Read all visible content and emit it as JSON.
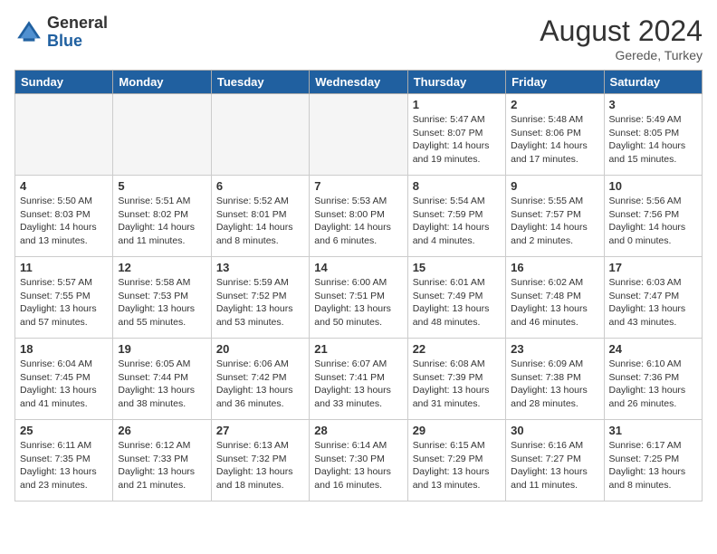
{
  "header": {
    "logo_general": "General",
    "logo_blue": "Blue",
    "month_year": "August 2024",
    "location": "Gerede, Turkey"
  },
  "weekdays": [
    "Sunday",
    "Monday",
    "Tuesday",
    "Wednesday",
    "Thursday",
    "Friday",
    "Saturday"
  ],
  "weeks": [
    [
      {
        "day": "",
        "info": "",
        "empty": true
      },
      {
        "day": "",
        "info": "",
        "empty": true
      },
      {
        "day": "",
        "info": "",
        "empty": true
      },
      {
        "day": "",
        "info": "",
        "empty": true
      },
      {
        "day": "1",
        "info": "Sunrise: 5:47 AM\nSunset: 8:07 PM\nDaylight: 14 hours\nand 19 minutes.",
        "empty": false
      },
      {
        "day": "2",
        "info": "Sunrise: 5:48 AM\nSunset: 8:06 PM\nDaylight: 14 hours\nand 17 minutes.",
        "empty": false
      },
      {
        "day": "3",
        "info": "Sunrise: 5:49 AM\nSunset: 8:05 PM\nDaylight: 14 hours\nand 15 minutes.",
        "empty": false
      }
    ],
    [
      {
        "day": "4",
        "info": "Sunrise: 5:50 AM\nSunset: 8:03 PM\nDaylight: 14 hours\nand 13 minutes.",
        "empty": false
      },
      {
        "day": "5",
        "info": "Sunrise: 5:51 AM\nSunset: 8:02 PM\nDaylight: 14 hours\nand 11 minutes.",
        "empty": false
      },
      {
        "day": "6",
        "info": "Sunrise: 5:52 AM\nSunset: 8:01 PM\nDaylight: 14 hours\nand 8 minutes.",
        "empty": false
      },
      {
        "day": "7",
        "info": "Sunrise: 5:53 AM\nSunset: 8:00 PM\nDaylight: 14 hours\nand 6 minutes.",
        "empty": false
      },
      {
        "day": "8",
        "info": "Sunrise: 5:54 AM\nSunset: 7:59 PM\nDaylight: 14 hours\nand 4 minutes.",
        "empty": false
      },
      {
        "day": "9",
        "info": "Sunrise: 5:55 AM\nSunset: 7:57 PM\nDaylight: 14 hours\nand 2 minutes.",
        "empty": false
      },
      {
        "day": "10",
        "info": "Sunrise: 5:56 AM\nSunset: 7:56 PM\nDaylight: 14 hours\nand 0 minutes.",
        "empty": false
      }
    ],
    [
      {
        "day": "11",
        "info": "Sunrise: 5:57 AM\nSunset: 7:55 PM\nDaylight: 13 hours\nand 57 minutes.",
        "empty": false
      },
      {
        "day": "12",
        "info": "Sunrise: 5:58 AM\nSunset: 7:53 PM\nDaylight: 13 hours\nand 55 minutes.",
        "empty": false
      },
      {
        "day": "13",
        "info": "Sunrise: 5:59 AM\nSunset: 7:52 PM\nDaylight: 13 hours\nand 53 minutes.",
        "empty": false
      },
      {
        "day": "14",
        "info": "Sunrise: 6:00 AM\nSunset: 7:51 PM\nDaylight: 13 hours\nand 50 minutes.",
        "empty": false
      },
      {
        "day": "15",
        "info": "Sunrise: 6:01 AM\nSunset: 7:49 PM\nDaylight: 13 hours\nand 48 minutes.",
        "empty": false
      },
      {
        "day": "16",
        "info": "Sunrise: 6:02 AM\nSunset: 7:48 PM\nDaylight: 13 hours\nand 46 minutes.",
        "empty": false
      },
      {
        "day": "17",
        "info": "Sunrise: 6:03 AM\nSunset: 7:47 PM\nDaylight: 13 hours\nand 43 minutes.",
        "empty": false
      }
    ],
    [
      {
        "day": "18",
        "info": "Sunrise: 6:04 AM\nSunset: 7:45 PM\nDaylight: 13 hours\nand 41 minutes.",
        "empty": false
      },
      {
        "day": "19",
        "info": "Sunrise: 6:05 AM\nSunset: 7:44 PM\nDaylight: 13 hours\nand 38 minutes.",
        "empty": false
      },
      {
        "day": "20",
        "info": "Sunrise: 6:06 AM\nSunset: 7:42 PM\nDaylight: 13 hours\nand 36 minutes.",
        "empty": false
      },
      {
        "day": "21",
        "info": "Sunrise: 6:07 AM\nSunset: 7:41 PM\nDaylight: 13 hours\nand 33 minutes.",
        "empty": false
      },
      {
        "day": "22",
        "info": "Sunrise: 6:08 AM\nSunset: 7:39 PM\nDaylight: 13 hours\nand 31 minutes.",
        "empty": false
      },
      {
        "day": "23",
        "info": "Sunrise: 6:09 AM\nSunset: 7:38 PM\nDaylight: 13 hours\nand 28 minutes.",
        "empty": false
      },
      {
        "day": "24",
        "info": "Sunrise: 6:10 AM\nSunset: 7:36 PM\nDaylight: 13 hours\nand 26 minutes.",
        "empty": false
      }
    ],
    [
      {
        "day": "25",
        "info": "Sunrise: 6:11 AM\nSunset: 7:35 PM\nDaylight: 13 hours\nand 23 minutes.",
        "empty": false
      },
      {
        "day": "26",
        "info": "Sunrise: 6:12 AM\nSunset: 7:33 PM\nDaylight: 13 hours\nand 21 minutes.",
        "empty": false
      },
      {
        "day": "27",
        "info": "Sunrise: 6:13 AM\nSunset: 7:32 PM\nDaylight: 13 hours\nand 18 minutes.",
        "empty": false
      },
      {
        "day": "28",
        "info": "Sunrise: 6:14 AM\nSunset: 7:30 PM\nDaylight: 13 hours\nand 16 minutes.",
        "empty": false
      },
      {
        "day": "29",
        "info": "Sunrise: 6:15 AM\nSunset: 7:29 PM\nDaylight: 13 hours\nand 13 minutes.",
        "empty": false
      },
      {
        "day": "30",
        "info": "Sunrise: 6:16 AM\nSunset: 7:27 PM\nDaylight: 13 hours\nand 11 minutes.",
        "empty": false
      },
      {
        "day": "31",
        "info": "Sunrise: 6:17 AM\nSunset: 7:25 PM\nDaylight: 13 hours\nand 8 minutes.",
        "empty": false
      }
    ]
  ]
}
